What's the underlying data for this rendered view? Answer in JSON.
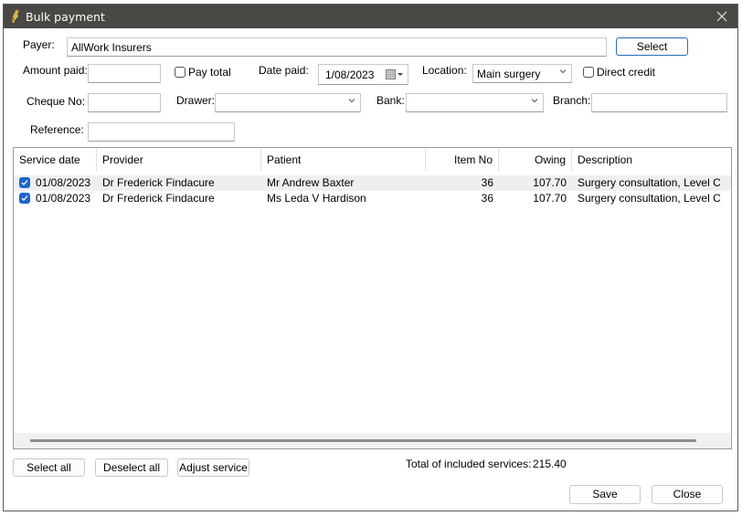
{
  "window": {
    "title": "Bulk payment",
    "close_glyph": "✕"
  },
  "form": {
    "payer_label": "Payer:",
    "payer_value": "AllWork Insurers",
    "select_label": "Select",
    "amount_paid_label": "Amount paid:",
    "amount_paid_value": "",
    "pay_total_label": "Pay total",
    "pay_total_checked": false,
    "date_paid_label": "Date paid:",
    "date_paid_value": "1/08/2023",
    "location_label": "Location:",
    "location_value": "Main surgery",
    "direct_credit_label": "Direct credit",
    "direct_credit_checked": false,
    "cheque_no_label": "Cheque No:",
    "cheque_no_value": "",
    "drawer_label": "Drawer:",
    "drawer_value": "",
    "bank_label": "Bank:",
    "bank_value": "",
    "branch_label": "Branch:",
    "branch_value": "",
    "reference_label": "Reference:",
    "reference_value": ""
  },
  "grid": {
    "columns": [
      "Service date",
      "Provider",
      "Patient",
      "Item No",
      "Owing",
      "Description"
    ],
    "rows": [
      {
        "checked": true,
        "service_date": "01/08/2023",
        "provider": "Dr Frederick Findacure",
        "patient": "Mr Andrew Baxter",
        "item_no": "36",
        "owing": "107.70",
        "description": "Surgery consultation, Level C"
      },
      {
        "checked": true,
        "service_date": "01/08/2023",
        "provider": "Dr Frederick Findacure",
        "patient": "Ms Leda V Hardison",
        "item_no": "36",
        "owing": "107.70",
        "description": "Surgery consultation, Level C"
      }
    ]
  },
  "footer": {
    "select_all_label": "Select all",
    "deselect_all_label": "Deselect all",
    "adjust_service_label": "Adjust service",
    "total_label": "Total of included services:",
    "total_value": "215.40",
    "save_label": "Save",
    "close_label": "Close"
  },
  "colors": {
    "titlebar": "#4a4845",
    "checkbox_checked": "#1b66c9",
    "primary_button_border": "#2a6cb5"
  }
}
